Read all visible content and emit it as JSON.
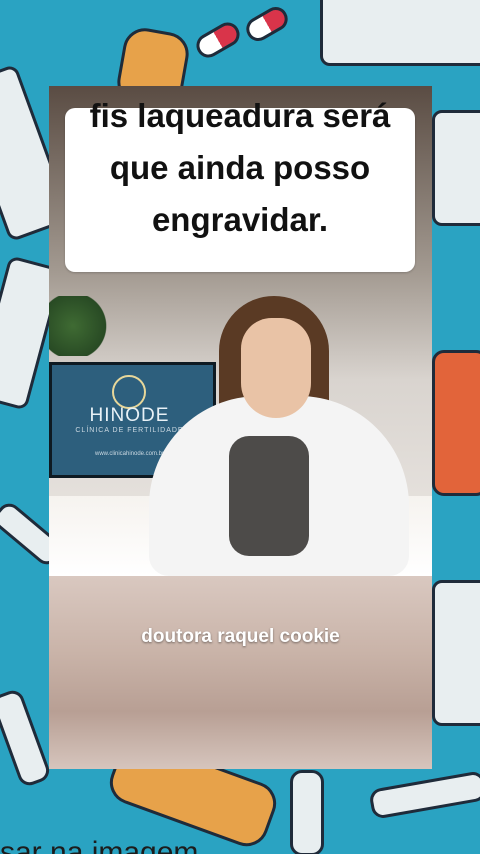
{
  "caption": {
    "text": "fis laqueadura será que ainda posso engravidar."
  },
  "monitor": {
    "brand": "HINODE",
    "subtitle": "CLÍNICA DE FERTILIDADE",
    "url": "www.clinicahinode.com.br"
  },
  "overlay": {
    "name": "doutora raquel cookie"
  },
  "footer": {
    "text": "sar na imagem"
  },
  "colors": {
    "background": "#2aa3c2",
    "caption_bg": "#ffffff",
    "caption_text": "#111111"
  }
}
